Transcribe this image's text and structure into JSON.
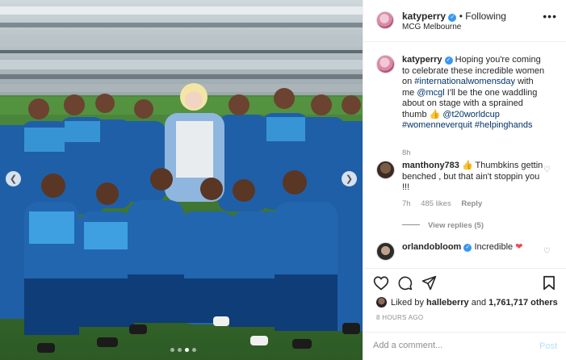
{
  "header": {
    "username": "katyperry",
    "separator": "•",
    "follow_status": "Following",
    "location": "MCG Melbourne",
    "more_icon": "more-horizontal-icon"
  },
  "caption": {
    "username": "katyperry",
    "parts": [
      {
        "t": "Hoping you're coming to celebrate these incredible women on ",
        "tag": false
      },
      {
        "t": "#internationalwomensday",
        "tag": true
      },
      {
        "t": " with me ",
        "tag": false
      },
      {
        "t": "@mcgl",
        "tag": true
      },
      {
        "t": " I'll be the one waddling about on stage with a sprained thumb 👍 ",
        "tag": false
      },
      {
        "t": "@t20worldcup",
        "tag": true
      },
      {
        "t": " ",
        "tag": false
      },
      {
        "t": "#womenneverquit",
        "tag": true
      },
      {
        "t": " ",
        "tag": false
      },
      {
        "t": "#helpinghands",
        "tag": true
      }
    ],
    "age": "8h"
  },
  "comments": [
    {
      "username": "manthony783",
      "text": "👍 Thumbkins gettin benched , but that ain't stoppin you !!!",
      "age": "7h",
      "likes": "485 likes",
      "reply": "Reply",
      "view_replies": "View replies (5)"
    },
    {
      "username": "orlandobloom",
      "text": "Incredible ",
      "heart": "❤"
    }
  ],
  "actions": {
    "liked_by_prefix": "Liked by",
    "liked_by_user": "halleberry",
    "liked_by_and": "and",
    "liked_by_count": "1,761,717 others",
    "timestamp": "8 HOURS AGO"
  },
  "composer": {
    "placeholder": "Add a comment...",
    "post_label": "Post"
  },
  "carousel": {
    "slide_count": 4,
    "active_slide": 3
  },
  "colors": {
    "link": "#003569",
    "verified": "#3897f0",
    "post_disabled": "#b2dffc",
    "heart": "#ed4956"
  }
}
